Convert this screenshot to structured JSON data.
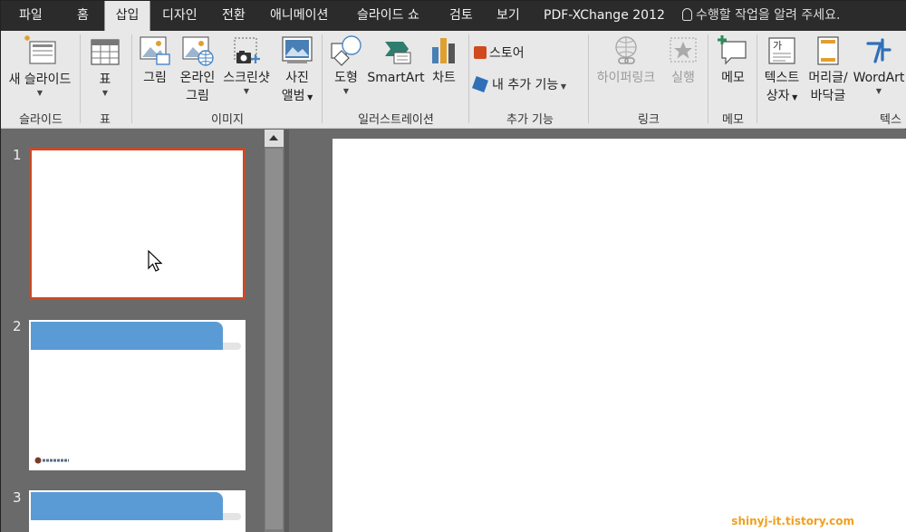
{
  "tabs": [
    "파일",
    "홈",
    "삽입",
    "디자인",
    "전환",
    "애니메이션",
    "슬라이드 쇼",
    "검토",
    "보기",
    "PDF-XChange 2012"
  ],
  "active_tab": "삽입",
  "tell_me": "수행할 작업을 알려 주세요.",
  "ribbon": {
    "new_slide": [
      "새 슬라이드"
    ],
    "table": "표",
    "picture": "그림",
    "online_picture": [
      "온라인",
      "그림"
    ],
    "screenshot": "스크린샷",
    "photo_album": [
      "사진",
      "앨범"
    ],
    "shapes": "도형",
    "smartart": "SmartArt",
    "chart": "차트",
    "store": "스토어",
    "my_addins": "내 추가 기능",
    "hyperlink": "하이퍼링크",
    "action": "실행",
    "comment": "메모",
    "textbox": [
      "텍스트",
      "상자"
    ],
    "header_footer": [
      "머리글/",
      "바닥글"
    ],
    "wordart": "WordArt",
    "groups": {
      "slides": "슬라이드",
      "table": "표",
      "images": "이미지",
      "illustrations": "일러스트레이션",
      "addins": "추가 기능",
      "links": "링크",
      "comments": "메모",
      "text": "텍스"
    }
  },
  "slides": [
    "1",
    "2",
    "3"
  ],
  "watermark": "shinyj-it.tistory.com",
  "colors": {
    "accent": "#c94a26",
    "title_bar": "#5b9bd5",
    "tab_bg": "#2b2b2b"
  }
}
